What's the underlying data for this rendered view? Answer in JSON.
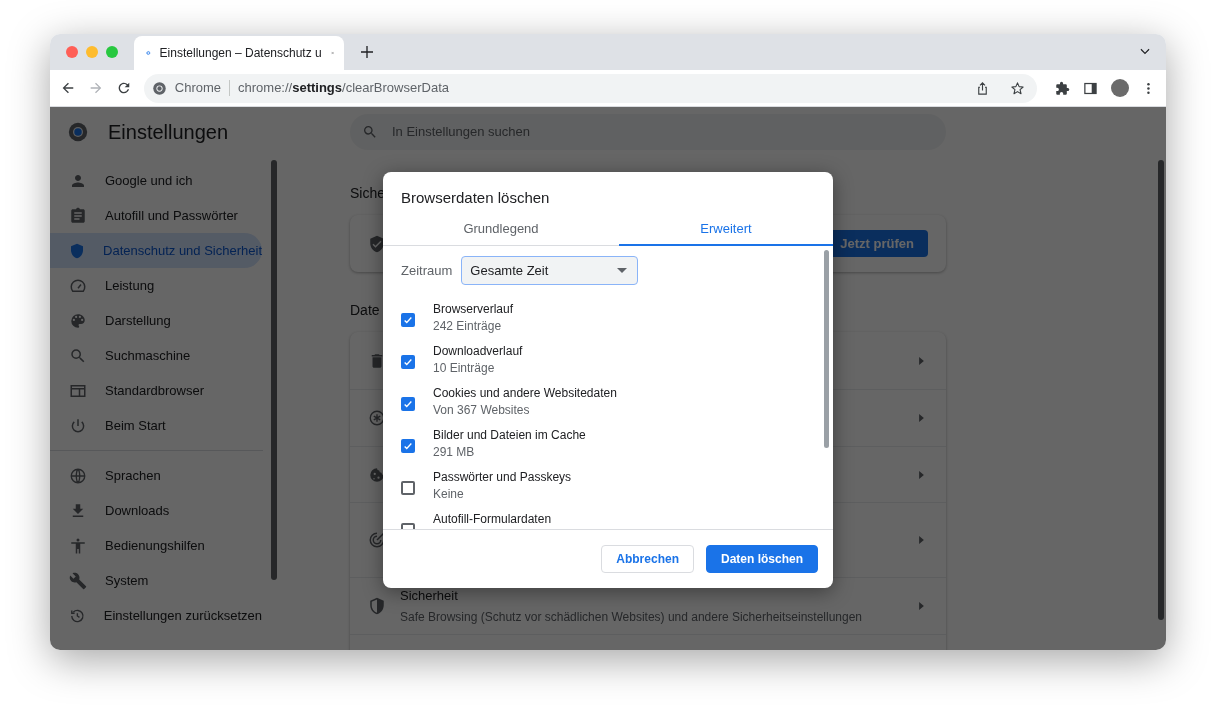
{
  "tabs": [
    {
      "title": "Einstellungen – Datenschutz u",
      "selected": true
    }
  ],
  "toolbar": {
    "site_label": "Chrome",
    "url": "chrome://**settings**/clearBrowserData"
  },
  "settings": {
    "title": "Einstellungen",
    "search_placeholder": "In Einstellungen suchen",
    "sidebar": {
      "groups": [
        {
          "items": [
            {
              "label": "Google und ich",
              "selected": false
            },
            {
              "label": "Autofill und Passwörter",
              "selected": false
            },
            {
              "label": "Datenschutz und Sicherheit",
              "selected": true
            },
            {
              "label": "Leistung",
              "selected": false
            },
            {
              "label": "Darstellung",
              "selected": false
            },
            {
              "label": "Suchmaschine",
              "selected": false
            },
            {
              "label": "Standardbrowser",
              "selected": false
            },
            {
              "label": "Beim Start",
              "selected": false
            }
          ]
        },
        {
          "items": [
            {
              "label": "Sprachen",
              "selected": false
            },
            {
              "label": "Downloads",
              "selected": false
            },
            {
              "label": "Bedienungshilfen",
              "selected": false
            },
            {
              "label": "System",
              "selected": false
            },
            {
              "label": "Einstellungen zurücksetzen",
              "selected": false
            }
          ]
        }
      ]
    },
    "safety_heading": "Siche",
    "safety_button": "Jetzt prüfen",
    "privacy_heading": "Date",
    "privacy_rows": [
      {},
      {},
      {},
      {},
      {
        "title": "Sicherheit",
        "subtitle": "Safe Browsing (Schutz vor schädlichen Websites) und andere Sicherheitseinstellungen"
      },
      {}
    ]
  },
  "dialog": {
    "title": "Browserdaten löschen",
    "tabs": [
      {
        "label": "Grundlegend",
        "selected": false
      },
      {
        "label": "Erweitert",
        "selected": true
      }
    ],
    "time_range": {
      "label": "Zeitraum",
      "value": "Gesamte Zeit"
    },
    "items": [
      {
        "label": "Browserverlauf",
        "detail": "242 Einträge",
        "checked": true
      },
      {
        "label": "Downloadverlauf",
        "detail": "10 Einträge",
        "checked": true
      },
      {
        "label": "Cookies und andere Websitedaten",
        "detail": "Von 367 Websites",
        "checked": true
      },
      {
        "label": "Bilder und Dateien im Cache",
        "detail": "291 MB",
        "checked": true
      },
      {
        "label": "Passwörter und Passkeys",
        "detail": "Keine",
        "checked": false
      },
      {
        "label": "Autofill-Formulardaten",
        "checked": false
      }
    ],
    "buttons": [
      {
        "label": "Abbrechen",
        "kind": "secondary"
      },
      {
        "label": "Daten löschen",
        "kind": "primary"
      }
    ]
  }
}
